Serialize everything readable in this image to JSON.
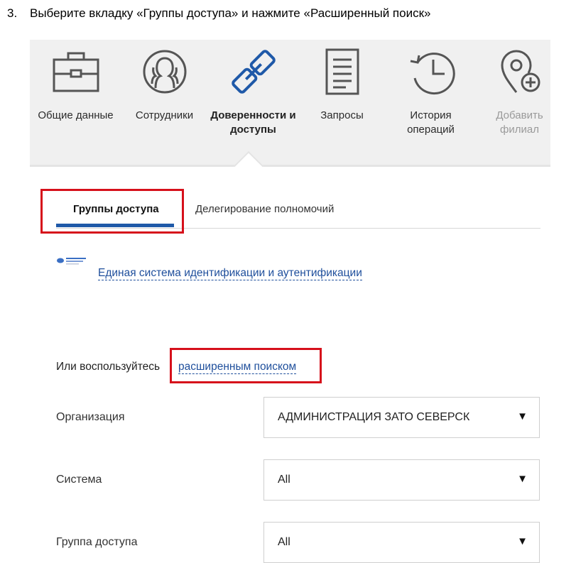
{
  "instruction": {
    "number": "3.",
    "text": "Выберите вкладку «Группы доступа» и нажмите «Расширенный поиск»"
  },
  "nav": [
    {
      "label": "Общие данные",
      "icon": "briefcase-icon"
    },
    {
      "label": "Сотрудники",
      "icon": "people-icon"
    },
    {
      "label": "Доверенности и доступы",
      "icon": "chain-link-icon"
    },
    {
      "label": "Запросы",
      "icon": "document-icon"
    },
    {
      "label": "История операций",
      "icon": "history-clock-icon"
    },
    {
      "label": "Добавить филиал",
      "icon": "add-location-icon"
    }
  ],
  "tabs": {
    "active": "Группы доступа",
    "other": "Делегирование полномочий"
  },
  "esia": {
    "link": "Единая система идентификации и аутентификации"
  },
  "advanced": {
    "prefix": "Или воспользуйтесь",
    "link": "расширенным поиском"
  },
  "filters": [
    {
      "label": "Организация",
      "value": "АДМИНИСТРАЦИЯ ЗАТО СЕВЕРСК"
    },
    {
      "label": "Система",
      "value": "All"
    },
    {
      "label": "Группа доступа",
      "value": "All"
    }
  ],
  "colors": {
    "accent": "#1f59a8",
    "link": "#1f4f9c",
    "highlight": "#d6101b",
    "icon": "#555555",
    "icon_active": "#1f59a8"
  }
}
